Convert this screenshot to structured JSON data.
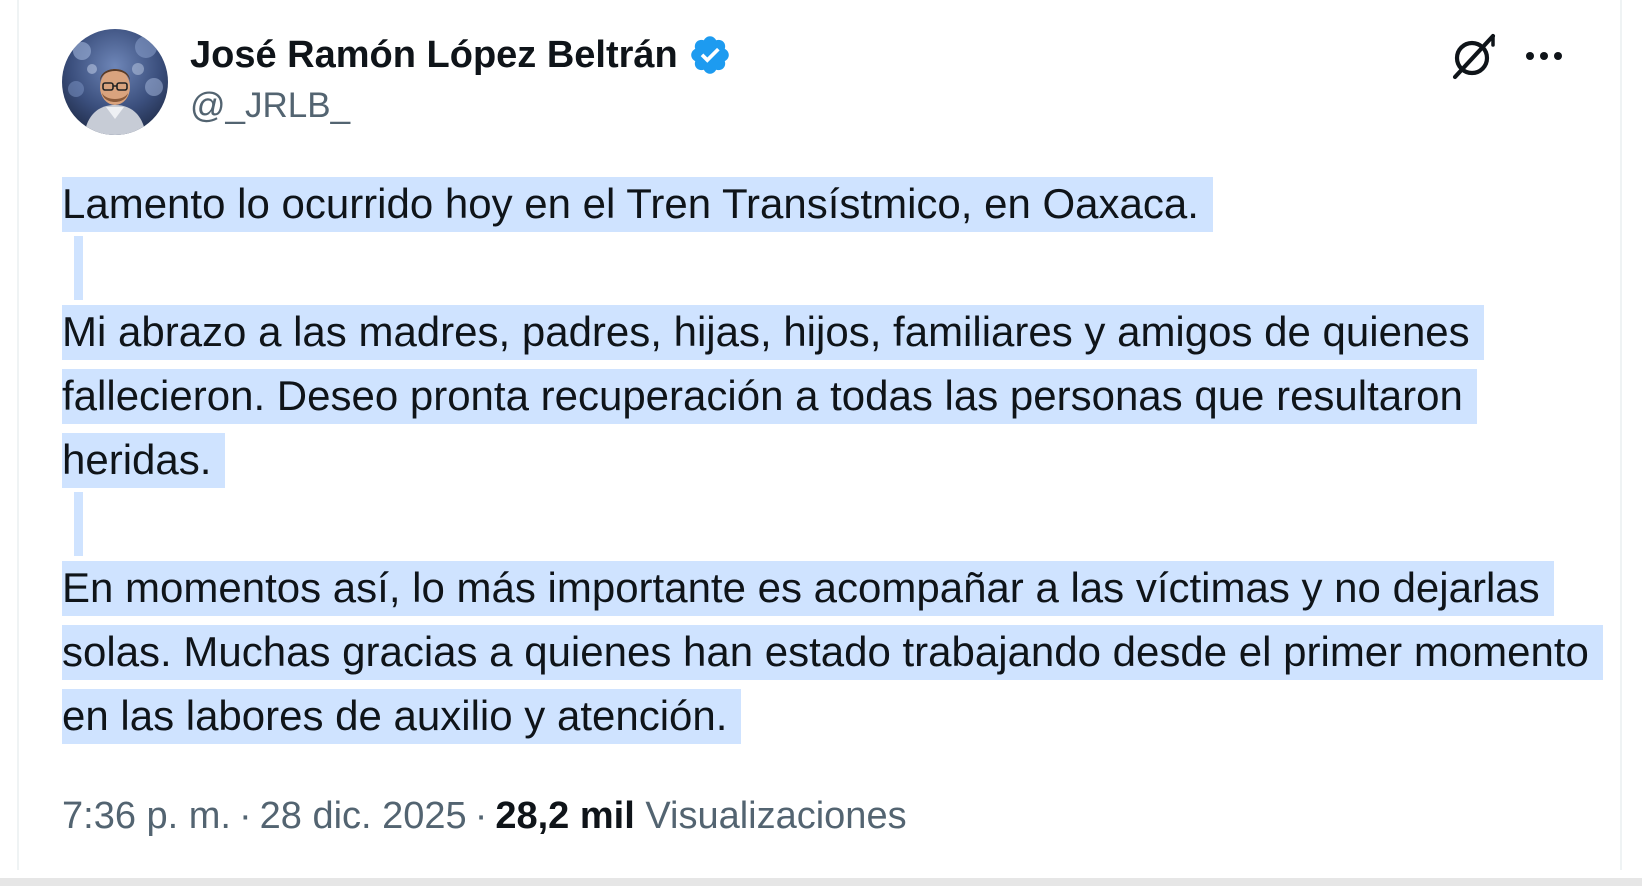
{
  "author": {
    "display_name": "José Ramón López Beltrán",
    "handle": "@_JRLB_",
    "verified": true,
    "verified_color": "#1d9bf0"
  },
  "header_actions": {
    "grok_icon": "grok-icon",
    "more_icon": "more-options-icon"
  },
  "tweet": {
    "paragraphs": [
      "Lamento lo ocurrido hoy en el Tren Transístmico, en Oaxaca.",
      "Mi abrazo a las madres, padres, hijas, hijos, familiares y amigos de quienes fallecieron. Deseo pronta recuperación a todas las personas que resultaron heridas.",
      "En momentos así, lo más importante es acompañar a las víctimas y no dejarlas solas. Muchas gracias a quienes han estado trabajando desde el primer momento en las labores de auxilio y atención."
    ],
    "selection_color": "#cfe3ff"
  },
  "meta": {
    "time": "7:36 p. m.",
    "separator": "·",
    "date": "28 dic. 2025",
    "views_count": "28,2 mil",
    "views_label": "Visualizaciones"
  }
}
